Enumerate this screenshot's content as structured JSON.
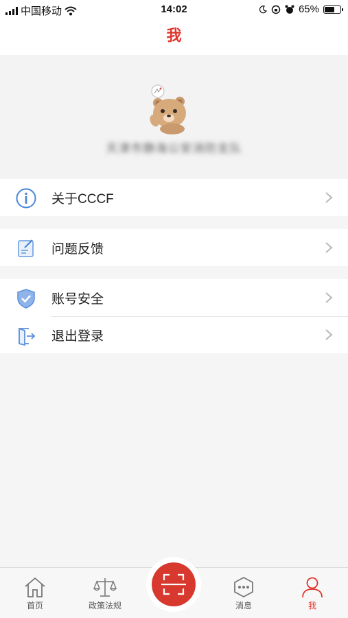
{
  "status_bar": {
    "carrier": "中国移动",
    "time": "14:02",
    "battery": "65%",
    "battery_level": 0.65
  },
  "header": {
    "title": "我"
  },
  "profile": {
    "org_name": "天津市静海公安消防支队"
  },
  "menu": [
    {
      "label": "关于CCCF",
      "icon": "info-icon"
    },
    {
      "label": "问题反馈",
      "icon": "feedback-icon"
    },
    {
      "label": "账号安全",
      "icon": "shield-icon"
    },
    {
      "label": "退出登录",
      "icon": "logout-icon"
    }
  ],
  "tabbar": {
    "items": [
      {
        "label": "首页",
        "icon": "home-icon"
      },
      {
        "label": "政策法规",
        "icon": "scales-icon"
      },
      {
        "label": "",
        "icon": "scan-icon"
      },
      {
        "label": "消息",
        "icon": "message-icon"
      },
      {
        "label": "我",
        "icon": "user-icon"
      }
    ],
    "active": 4
  },
  "colors": {
    "accent": "#e0352b",
    "icon_blue": "#4a86d8",
    "background": "#f5f5f5"
  }
}
